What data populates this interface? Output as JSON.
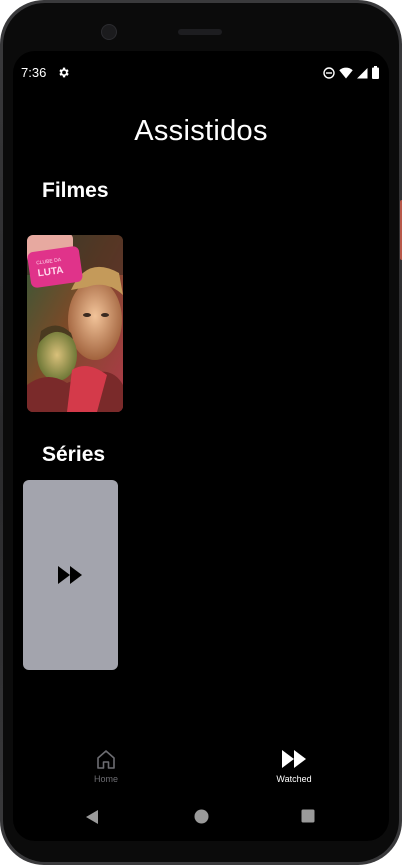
{
  "status_bar": {
    "time": "7:36",
    "icons": [
      "settings-icon",
      "do-not-disturb-icon",
      "wifi-icon",
      "signal-icon",
      "battery-icon"
    ]
  },
  "screen": {
    "title": "Assistidos"
  },
  "sections": {
    "movies": {
      "title": "Filmes",
      "items": [
        {
          "poster_text": "CLUBE DA LUTA"
        }
      ]
    },
    "series": {
      "title": "Séries",
      "items": [
        {
          "placeholder_icon": "fast-forward-icon"
        }
      ]
    }
  },
  "bottom_nav": {
    "items": [
      {
        "label": "Home",
        "icon": "home-icon",
        "active": false
      },
      {
        "label": "Watched",
        "icon": "fast-forward-icon",
        "active": true
      }
    ]
  },
  "system_nav": {
    "buttons": [
      "back-icon",
      "home-circle-icon",
      "recents-icon"
    ]
  },
  "colors": {
    "background": "#000000",
    "placeholder_card": "#a3a4ad",
    "inactive_nav": "#6d6d72",
    "active_nav": "#ffffff"
  }
}
